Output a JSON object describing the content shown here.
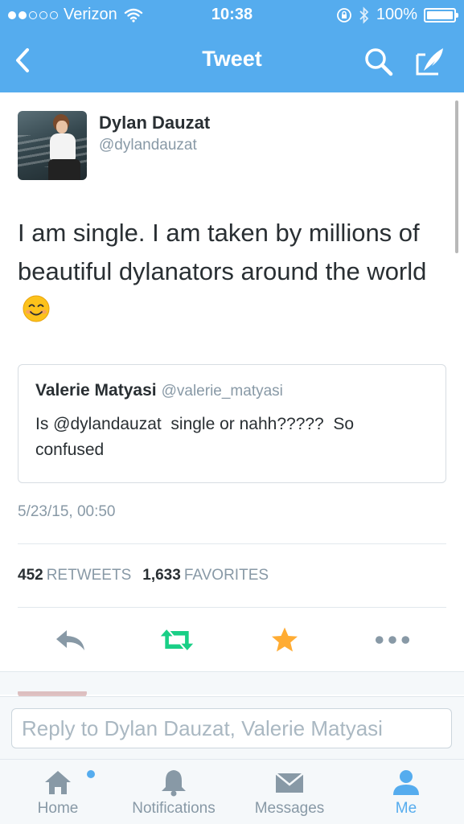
{
  "status_bar": {
    "carrier": "Verizon",
    "time": "10:38",
    "battery": "100%"
  },
  "nav": {
    "title": "Tweet",
    "icons": [
      "back-chevron-icon",
      "search-icon",
      "compose-icon"
    ]
  },
  "tweet": {
    "author_name": "Dylan Dauzat",
    "author_handle": "@dylandauzat",
    "text": "I am single. I am taken by millions of beautiful dylanators around the world",
    "emoji": "smiling-face-icon",
    "quote": {
      "name": "Valerie Matyasi",
      "handle": "@valerie_matyasi",
      "text": "Is @dylandauzat  single or nahh?????  So confused"
    },
    "timestamp": "5/23/15, 00:50",
    "retweet_count": "452",
    "retweet_label": "RETWEETS",
    "favorite_count": "1,633",
    "favorite_label": "FAVORITES"
  },
  "actions": [
    "reply-icon",
    "retweet-icon",
    "favorite-star-icon",
    "more-icon"
  ],
  "colors": {
    "brand_blue": "#55acee",
    "retweet_green": "#19cf86",
    "favorite_orange": "#ffac33",
    "muted_gray": "#8899a6"
  },
  "reply": {
    "placeholder": "Reply to Dylan Dauzat, Valerie Matyasi"
  },
  "tabbar": {
    "items": [
      {
        "label": "Home",
        "icon": "home-icon"
      },
      {
        "label": "Notifications",
        "icon": "bell-icon"
      },
      {
        "label": "Messages",
        "icon": "envelope-icon"
      },
      {
        "label": "Me",
        "icon": "person-icon"
      }
    ],
    "active": "Me"
  }
}
